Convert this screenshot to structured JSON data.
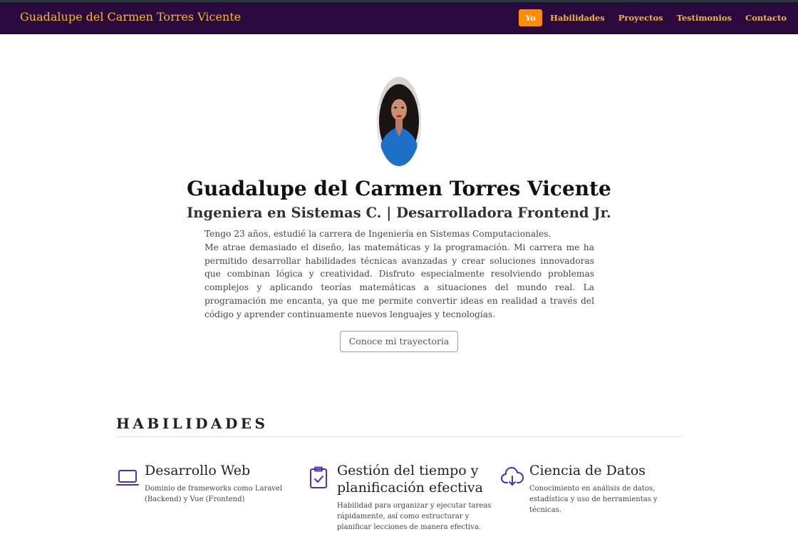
{
  "navbar": {
    "brand": "Guadalupe del Carmen Torres Vicente",
    "items": [
      {
        "label": "Yo",
        "active": true
      },
      {
        "label": "Habilidades",
        "active": false
      },
      {
        "label": "Proyectos",
        "active": false
      },
      {
        "label": "Testimonios",
        "active": false
      },
      {
        "label": "Contacto",
        "active": false
      }
    ]
  },
  "hero": {
    "name": "Guadalupe del Carmen Torres Vicente",
    "role": "Ingeniera en Sistemas C. | Desarrolladora Frontend Jr.",
    "bio_line1": "Tengo 23 años, estudié la carrera de Ingeniería en Sistemas Computacionales.",
    "bio_line2": "Me atrae demasiado el diseño, las matemáticas y la programación. Mi carrera me ha permitido desarrollar habilidades técnicas avanzadas y crear soluciones innovadoras que combinan lógica y creatividad. Disfruto especialmente resolviendo problemas complejos y aplicando teorías matemáticas a situaciones del mundo real. La programación me encanta, ya que me permite convertir ideas en realidad a través del código y aprender continuamente nuevos lenguajes y tecnologías.",
    "cta_label": "Conoce mi trayectoria"
  },
  "skills": {
    "title": "HABILIDADES",
    "items": [
      {
        "icon": "laptop-icon",
        "title": "Desarrollo Web",
        "description": "Dominio de frameworks como Laravel (Backend) y Vue (Frontend)"
      },
      {
        "icon": "clipboard-check-icon",
        "title": "Gestión del tiempo y planificación efectiva",
        "description": "Habilidad para organizar y ejecutar tareas rápidamente, así como estructurar y planificar lecciones de manera efectiva."
      },
      {
        "icon": "cloud-download-icon",
        "title": "Ciencia de Datos",
        "description": "Conocimiento en análisis de datos, estadística y uso de herramientas y técnicas."
      }
    ]
  },
  "colors": {
    "navbar_bg": "#2a0a3e",
    "brand": "#f5b731",
    "active_nav": "#ff8c00",
    "icon": "#4b2fbf"
  }
}
